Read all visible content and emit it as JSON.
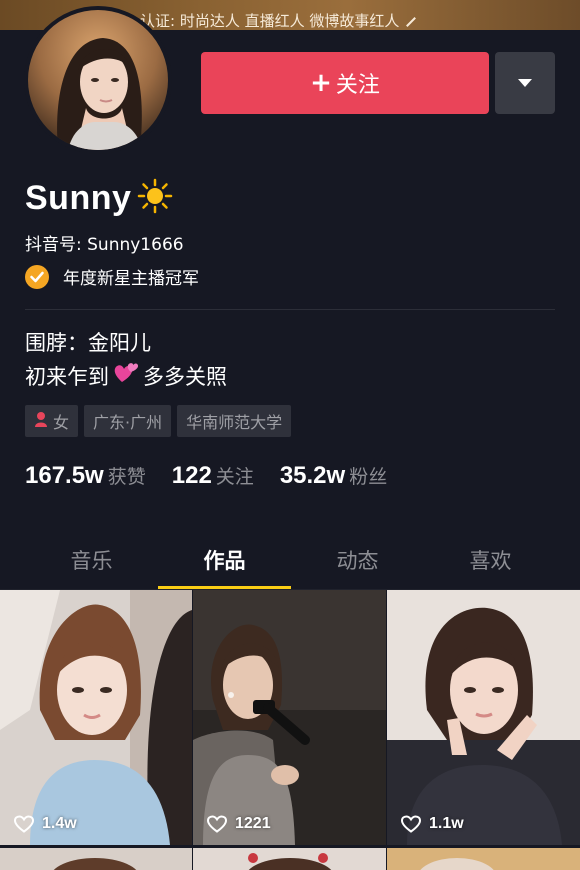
{
  "banner": {
    "cert_text": "认证: 时尚达人 直播红人 微博故事红人"
  },
  "profile": {
    "avatar_icon": "avatar-photo",
    "display_name": "Sunny",
    "name_emoji": "sun-icon",
    "douyin_id": "抖音号: Sunny1666",
    "award": "年度新星主播冠军",
    "bio_line1": "围脖：金阳儿",
    "bio_line2_before": "初来乍到",
    "bio_line2_after": "多多关照",
    "tags": {
      "gender": "女",
      "location": "广东·广州",
      "school": "华南师范大学"
    }
  },
  "actions": {
    "follow_label": "关注",
    "more_icon": "chevron-down-icon"
  },
  "stats": {
    "likes_num": "167.5w",
    "likes_label": "获赞",
    "following_num": "122",
    "following_label": "关注",
    "followers_num": "35.2w",
    "followers_label": "粉丝"
  },
  "tabs": [
    {
      "label": "音乐"
    },
    {
      "label": "作品"
    },
    {
      "label": "动态"
    },
    {
      "label": "喜欢"
    }
  ],
  "active_tab": "作品",
  "videos": [
    {
      "likes": "1.4w"
    },
    {
      "likes": "1221"
    },
    {
      "likes": "1.1w"
    }
  ],
  "colors": {
    "background": "#161823",
    "follow_button": "#ea4459",
    "tab_indicator": "#face15",
    "award_badge": "#f5a623"
  }
}
